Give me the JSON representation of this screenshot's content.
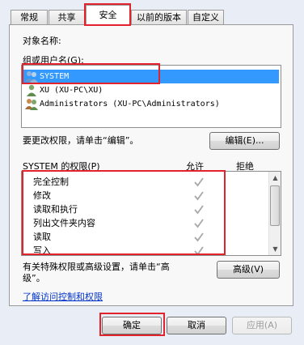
{
  "tabs": [
    {
      "label": "常规",
      "active": false
    },
    {
      "label": "共享",
      "active": false
    },
    {
      "label": "安全",
      "active": true
    },
    {
      "label": "以前的版本",
      "active": false
    },
    {
      "label": "自定义",
      "active": false
    }
  ],
  "object_name_label": "对象名称:",
  "group_label": "组或用户名(G):",
  "users": [
    {
      "name": "SYSTEM",
      "selected": true,
      "icon": "user-group-icon"
    },
    {
      "name": "XU (XU-PC\\XU)",
      "selected": false,
      "icon": "user-icon"
    },
    {
      "name": "Administrators (XU-PC\\Administrators)",
      "selected": false,
      "icon": "user-group-icon"
    }
  ],
  "edit_prompt": "要更改权限，请单击“编辑”。",
  "edit_button": "编辑(E)...",
  "perm_header": {
    "title": "SYSTEM 的权限(P)",
    "allow": "允许",
    "deny": "拒绝"
  },
  "permissions": [
    {
      "name": "完全控制",
      "allow": true,
      "deny": false
    },
    {
      "name": "修改",
      "allow": true,
      "deny": false
    },
    {
      "name": "读取和执行",
      "allow": true,
      "deny": false
    },
    {
      "name": "列出文件夹内容",
      "allow": true,
      "deny": false
    },
    {
      "name": "读取",
      "allow": true,
      "deny": false
    },
    {
      "name": "写入",
      "allow": true,
      "deny": false
    }
  ],
  "advanced_text_line1": "有关特殊权限或高级设置，请单击“高",
  "advanced_text_line2": "级”。",
  "advanced_button": "高级(V)",
  "learn_link": "了解访问控制和权限",
  "ok_button": "确定",
  "cancel_button": "取消",
  "apply_button": "应用(A)",
  "colors": {
    "highlight": "#e3232c",
    "selection": "#3399ff",
    "link": "#0033cc"
  }
}
